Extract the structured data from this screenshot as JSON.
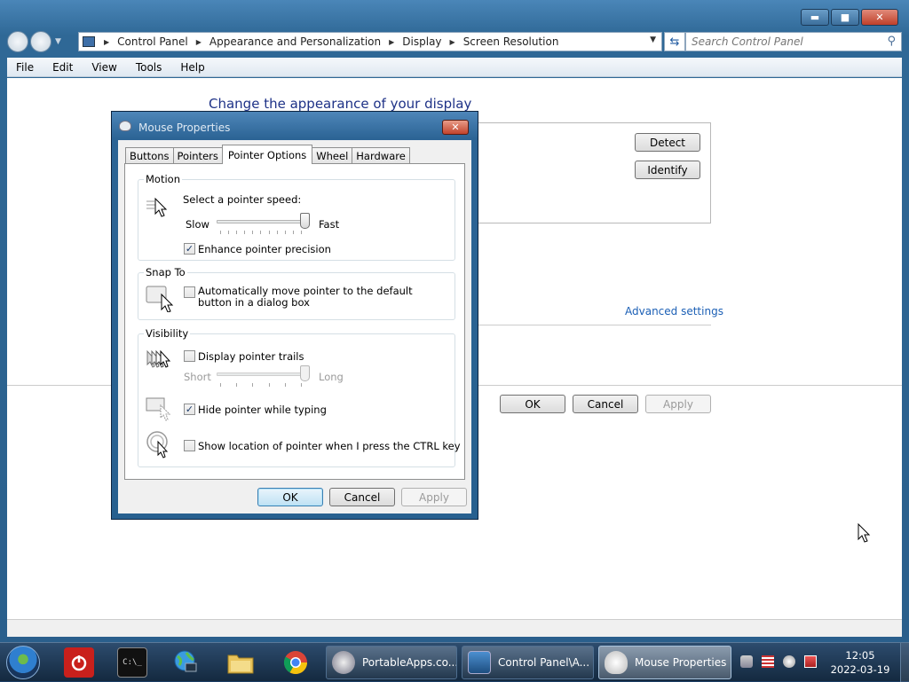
{
  "window": {
    "caption_buttons": {
      "minimize": "▬",
      "maximize": "■",
      "close": "✕"
    },
    "breadcrumb": [
      "Control Panel",
      "Appearance and Personalization",
      "Display",
      "Screen Resolution"
    ],
    "search_placeholder": "Search Control Panel",
    "menu": [
      "File",
      "Edit",
      "View",
      "Tools",
      "Help"
    ],
    "content_title": "Change the appearance of your display",
    "detect_label": "Detect",
    "identify_label": "Identify",
    "advanced_link": "Advanced settings",
    "ok_label": "OK",
    "cancel_label": "Cancel",
    "apply_label": "Apply"
  },
  "dialog": {
    "title": "Mouse Properties",
    "close_glyph": "✕",
    "tabs": [
      "Buttons",
      "Pointers",
      "Pointer Options",
      "Wheel",
      "Hardware"
    ],
    "active_tab": "Pointer Options",
    "motion": {
      "title": "Motion",
      "speed_label": "Select a pointer speed:",
      "slow": "Slow",
      "fast": "Fast",
      "speed_value": 1.0,
      "enhance_label": "Enhance pointer precision",
      "enhance_checked": true
    },
    "snap_to": {
      "title": "Snap To",
      "label": "Automatically move pointer to the default button in a dialog box",
      "checked": false
    },
    "visibility": {
      "title": "Visibility",
      "trails_label": "Display pointer trails",
      "trails_checked": false,
      "short": "Short",
      "long": "Long",
      "trail_length_value": 1.0,
      "hide_label": "Hide pointer while typing",
      "hide_checked": true,
      "ctrl_label": "Show location of pointer when I press the CTRL key",
      "ctrl_checked": false
    },
    "ok_label": "OK",
    "cancel_label": "Cancel",
    "apply_label": "Apply",
    "check_glyph": "✓"
  },
  "taskbar": {
    "tasks": [
      {
        "label": "PortableApps.co...",
        "icon": "portableapps-icon",
        "active": false
      },
      {
        "label": "Control Panel\\A...",
        "icon": "control-panel-icon",
        "active": false
      },
      {
        "label": "Mouse Properties",
        "icon": "mouse-icon",
        "active": true
      }
    ],
    "pinned": [
      "shutdown-icon",
      "command-prompt-icon",
      "network-globe-icon",
      "file-explorer-icon",
      "chrome-icon"
    ],
    "clock_time": "12:05",
    "clock_date": "2022-03-19"
  }
}
